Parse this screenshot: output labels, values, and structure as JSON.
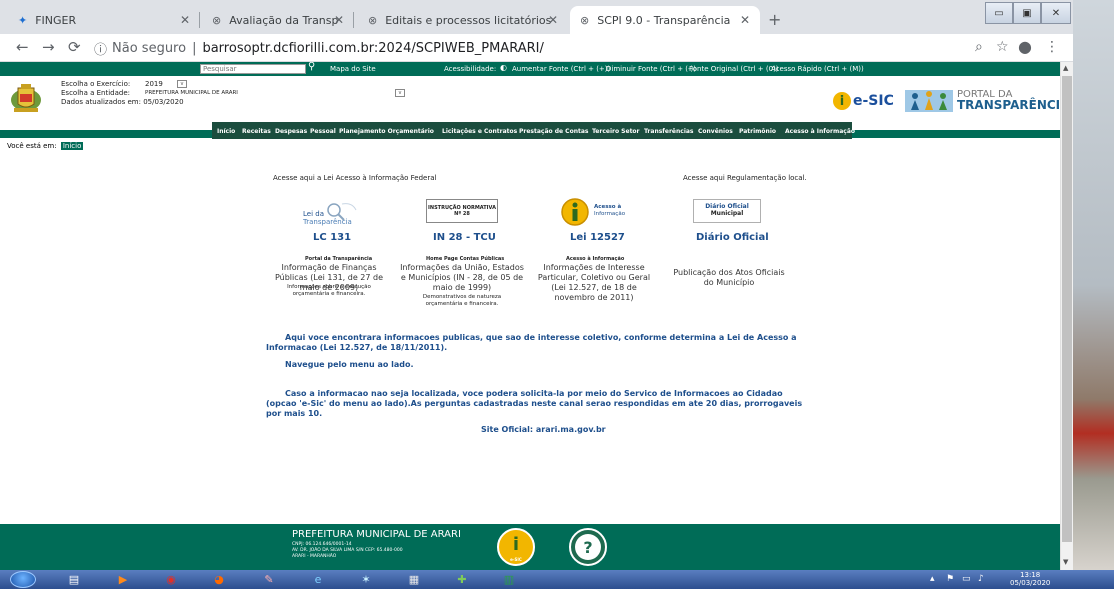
{
  "browser": {
    "tabs": [
      {
        "title": "FINGER",
        "icon": "finger-icon"
      },
      {
        "title": "Avaliação da Transparência dos /",
        "icon": "globe-icon"
      },
      {
        "title": "Editais e processos licitatórios",
        "icon": "globe-icon"
      },
      {
        "title": "SCPI 9.0 - Transparência",
        "icon": "globe-icon"
      }
    ],
    "new_tab": "+",
    "security_label": "Não seguro",
    "url": "barrosoptr.dcfiorilli.com.br:2024/SCPIWEB_PMARARI/"
  },
  "topbar": {
    "search_placeholder": "Pesquisar",
    "site_map": "Mapa do Site",
    "accessibility_label": "Acessibilidade:",
    "links": [
      "Aumentar Fonte (Ctrl + (+))",
      "Diminuir Fonte (Ctrl + (-))",
      "Fonte Original (Ctrl + (0))",
      "Acesso Rápido (Ctrl + (M))"
    ]
  },
  "header": {
    "exercise_label": "Escolha o Exercício:",
    "exercise_value": "2019",
    "entity_label": "Escolha a Entidade:",
    "entity_value": "PREFEITURA MUNICIPAL DE ARARI",
    "updated": "Dados atualizados em: 05/03/2020",
    "esic": "e-SIC",
    "portal_line1": "PORTAL DA",
    "portal_line2": "TRANSPARÊNCIA"
  },
  "menu": [
    "Início",
    "Receitas",
    "Despesas",
    "Pessoal",
    "Planejamento Orçamentário",
    "Licitações e Contratos",
    "Prestação de Contas",
    "Terceiro Setor",
    "Transferências",
    "Convênios",
    "Patrimônio",
    "Acesso à Informação"
  ],
  "breadcrumb": {
    "label": "Você está em:",
    "current": "Início"
  },
  "content": {
    "federal_head": "Acesse aqui a Lei Acesso à Informação Federal",
    "local_head": "Acesse aqui Regulamentação local.",
    "cards": [
      {
        "logo_line1": "Lei da",
        "logo_line2": "Transparência",
        "title": "LC 131",
        "sub": "Portal da Transparência",
        "desc": "Informação de Finanças Públicas (Lei 131, de 27 de maio de 2009)",
        "small": "Informações sobre a execução orçamentária e financeira."
      },
      {
        "logo_line1": "INSTRUÇÃO NORMATIVA",
        "logo_line2": "Nº 28",
        "title": "IN 28 - TCU",
        "sub": "Home Page Contas Públicas",
        "desc": "Informações da União, Estados e Municípios (IN - 28, de 05 de maio de 1999)",
        "small": "Demonstrativos de natureza orçamentária e financeira."
      },
      {
        "logo_line1": "Acesso à",
        "logo_line2": "Informação",
        "title": "Lei 12527",
        "sub": "Acesso à Informação",
        "desc": "Informações de Interesse Particular, Coletivo ou Geral (Lei 12.527, de 18 de novembro de 2011)",
        "small": ""
      },
      {
        "logo_line1": "Diário Oficial",
        "logo_line2": "Municipal",
        "title": "Diário Oficial",
        "sub": "",
        "desc": "Publicação dos Atos Oficiais do Município",
        "small": ""
      }
    ],
    "para1": "Aqui voce encontrara informacoes publicas, que sao de interesse coletivo, conforme determina a Lei de Acesso a Informacao (Lei 12.527, de 18/11/2011).",
    "para2": "Navegue pelo menu ao lado.",
    "para3": "Caso a informacao nao seja localizada, voce podera solicita-la por meio do Servico de Informacoes ao Cidadao (opcao 'e-Sic' do menu ao lado).As perguntas cadastradas neste canal serao respondidas em ate 20 dias, prorrogaveis por mais 10.",
    "site": "Site Oficial: arari.ma.gov.br"
  },
  "footer": {
    "title": "PREFEITURA MUNICIPAL DE ARARI",
    "cnpj": "CNPJ: 06.124.646/0001-14",
    "address": "AV. DR. JOÃO DA SILVA LIMA S/N CEP: 65.480-000",
    "city": "ARARI - MARANHÃO",
    "esic_label": "e-SIC",
    "help": "?"
  },
  "taskbar": {
    "time": "13:18",
    "date": "05/03/2020"
  },
  "colors": {
    "green": "#006c57",
    "dark_green": "#1b4d3e",
    "blue_text": "#1e4f8c"
  }
}
